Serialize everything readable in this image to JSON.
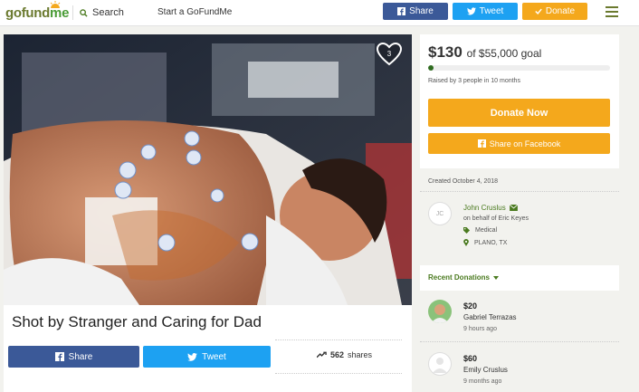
{
  "topbar": {
    "logo_go": "go",
    "logo_fund": "fund",
    "logo_me": "me",
    "search_label": "Search",
    "start_label": "Start a GoFundMe",
    "share_label": "Share",
    "tweet_label": "Tweet",
    "donate_label": "Donate"
  },
  "campaign": {
    "title": "Shot by Stranger and Caring for Dad",
    "heart_count": "3",
    "share_label": "Share",
    "tweet_label": "Tweet",
    "shares_count": "562",
    "shares_label": "shares"
  },
  "goal": {
    "raised": "$130",
    "goal_text": "of $55,000 goal",
    "progress_fraction": 0.0024,
    "raised_by": "Raised by 3 people in 10 months",
    "donate_label": "Donate Now",
    "share_facebook_label": "Share on Facebook"
  },
  "organizer": {
    "created": "Created October 4, 2018",
    "initials": "JC",
    "name": "John Cruslus",
    "behalf": "on behalf of Eric Keyes",
    "category": "Medical",
    "location": "PLANO, TX"
  },
  "recent": {
    "title": "Recent Donations",
    "donations": [
      {
        "amount": "$20",
        "name": "Gabriel Terrazas",
        "time": "9 hours ago"
      },
      {
        "amount": "$60",
        "name": "Emily Cruslus",
        "time": "9 months ago"
      }
    ]
  },
  "colors": {
    "facebook": "#3b5998",
    "twitter": "#1da1f2",
    "donate": "#f4a81c",
    "brand_green": "#4a7a1f"
  }
}
